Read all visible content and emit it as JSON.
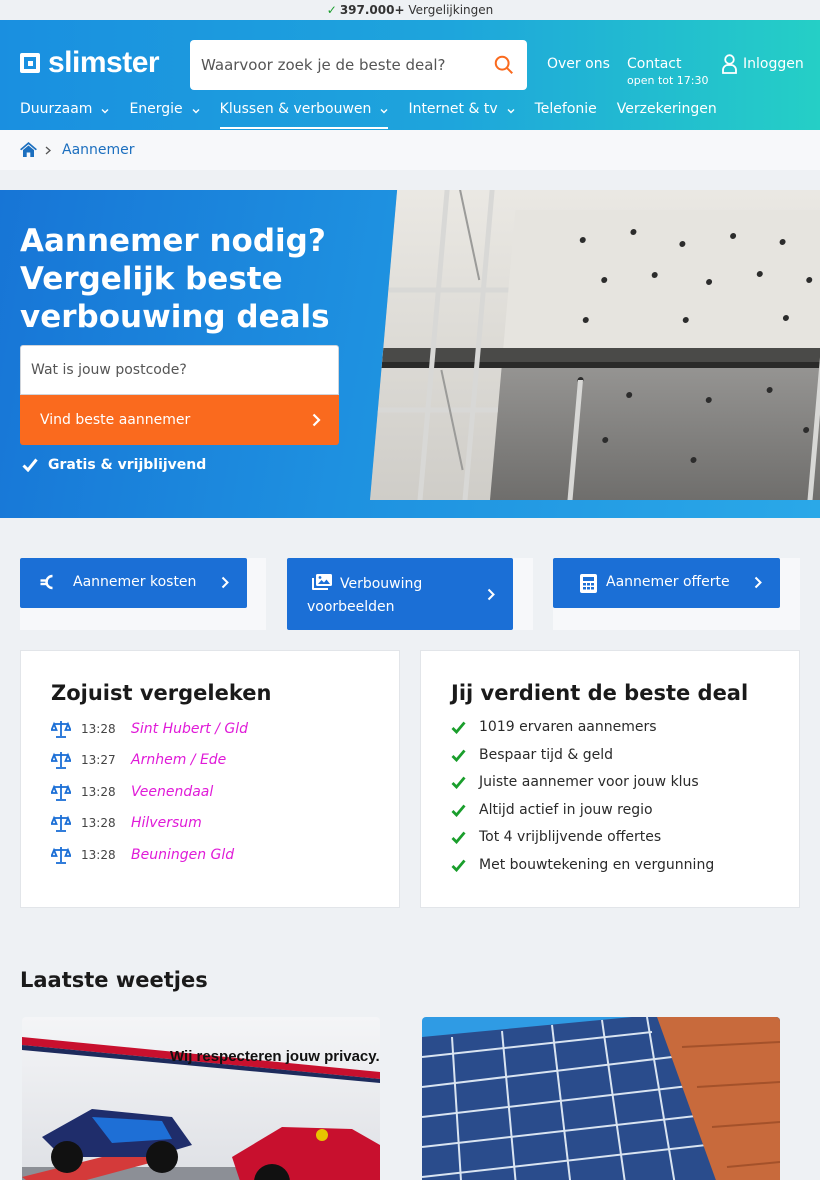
{
  "topstrip": {
    "count": "397.000+",
    "label": "Vergelijkingen"
  },
  "header": {
    "logo": "slimster",
    "search_placeholder": "Waarvoor zoek je de beste deal?",
    "about": "Over ons",
    "contact": "Contact",
    "contact_hours": "open tot 17:30",
    "login": "Inloggen"
  },
  "nav": [
    {
      "label": "Duurzaam",
      "dropdown": true
    },
    {
      "label": "Energie",
      "dropdown": true
    },
    {
      "label": "Klussen & verbouwen",
      "dropdown": true,
      "active": true
    },
    {
      "label": "Internet & tv",
      "dropdown": true
    },
    {
      "label": "Telefonie",
      "dropdown": false
    },
    {
      "label": "Verzekeringen",
      "dropdown": false
    }
  ],
  "breadcrumb": {
    "current": "Aannemer"
  },
  "hero": {
    "title": "Aannemer nodig? Vergelijk beste verbouwing deals",
    "postcode_placeholder": "Wat is jouw postcode?",
    "cta": "Vind beste aannemer",
    "note": "Gratis & vrijblijvend"
  },
  "quicklinks": [
    {
      "label": "Aannemer kosten",
      "icon": "euro-icon"
    },
    {
      "label": "Verbouwing voorbeelden",
      "icon": "images-icon"
    },
    {
      "label": "Aannemer offerte",
      "icon": "calculator-icon"
    }
  ],
  "recent": {
    "title": "Zojuist vergeleken",
    "rows": [
      {
        "time": "13:28",
        "city": "Sint Hubert / Gld"
      },
      {
        "time": "13:27",
        "city": "Arnhem / Ede"
      },
      {
        "time": "13:28",
        "city": "Veenendaal"
      },
      {
        "time": "13:28",
        "city": "Hilversum"
      },
      {
        "time": "13:28",
        "city": "Beuningen Gld"
      }
    ]
  },
  "benefits": {
    "title": "Jij verdient de beste deal",
    "items": [
      "1019 ervaren aannemers",
      "Bespaar tijd & geld",
      "Juiste aannemer voor jouw klus",
      "Altijd actief in jouw regio",
      "Tot 4 vrijblijvende offertes",
      "Met bouwtekening en vergunning"
    ]
  },
  "news": {
    "title": "Laatste weetjes"
  },
  "privacy": "Wij respecteren jouw privacy.",
  "colors": {
    "primary": "#1b6fd6",
    "accent": "#fa6a1e",
    "check": "#1a9e2c",
    "city": "#e01bd8"
  }
}
